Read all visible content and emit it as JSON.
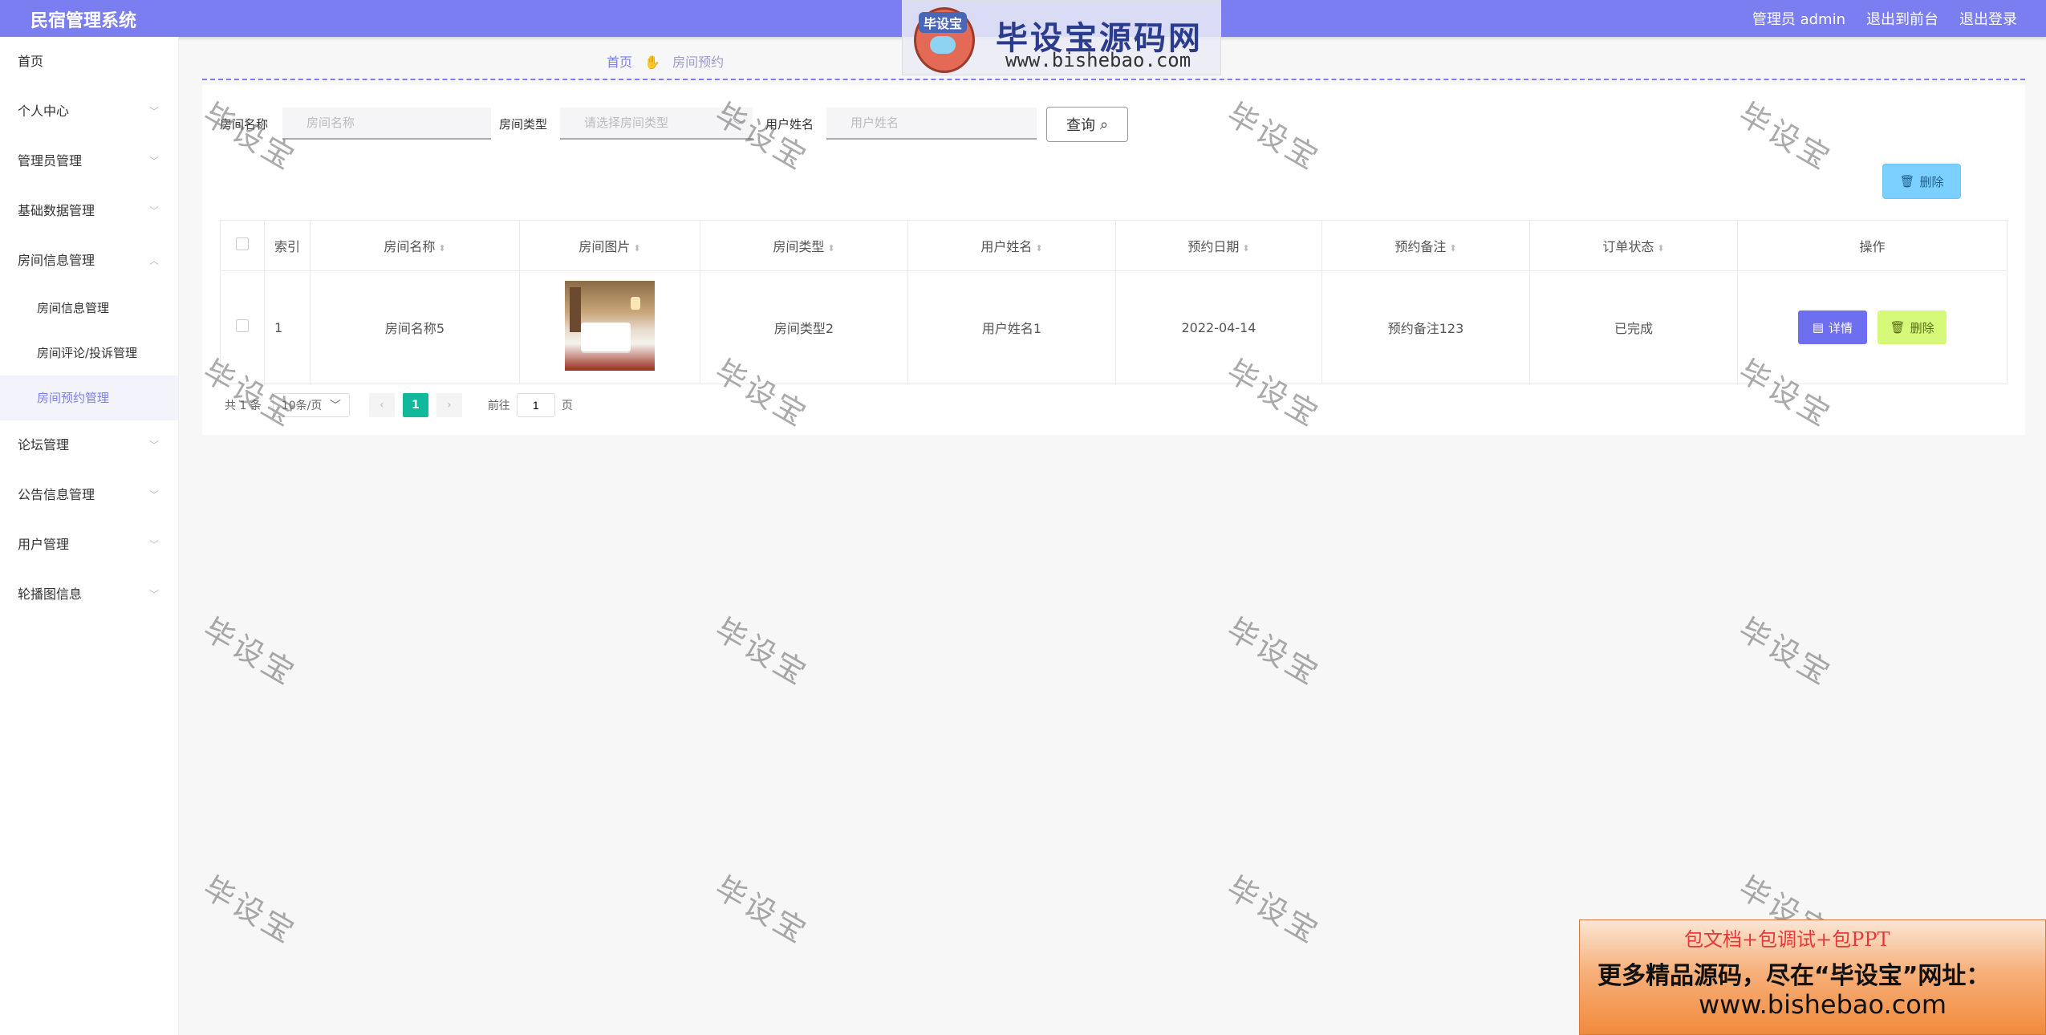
{
  "header": {
    "title": "民宿管理系统",
    "admin_label": "管理员 admin",
    "exit_front": "退出到前台",
    "logout": "退出登录",
    "brand_color": "#7b7ef0"
  },
  "watermark_logo": {
    "tag": "毕设宝",
    "title": "毕设宝源码网",
    "url": "www.bishebao.com"
  },
  "sidebar": {
    "items": [
      {
        "label": "首页"
      },
      {
        "label": "个人中心"
      },
      {
        "label": "管理员管理"
      },
      {
        "label": "基础数据管理"
      },
      {
        "label": "房间信息管理"
      },
      {
        "label": "论坛管理"
      },
      {
        "label": "公告信息管理"
      },
      {
        "label": "用户管理"
      },
      {
        "label": "轮播图信息"
      }
    ],
    "subitems": [
      {
        "label": "房间信息管理"
      },
      {
        "label": "房间评论/投诉管理"
      },
      {
        "label": "房间预约管理"
      }
    ]
  },
  "breadcrumb": {
    "home": "首页",
    "current": "房间预约"
  },
  "search": {
    "room_name_label": "房间名称",
    "room_name_placeholder": "房间名称",
    "room_type_label": "房间类型",
    "room_type_placeholder": "请选择房间类型",
    "user_name_label": "用户姓名",
    "user_name_placeholder": "用户姓名",
    "query_label": "查询"
  },
  "toolbar": {
    "delete_label": "删除"
  },
  "table": {
    "headers": [
      "索引",
      "房间名称",
      "房间图片",
      "房间类型",
      "用户姓名",
      "预约日期",
      "预约备注",
      "订单状态",
      "操作"
    ],
    "rows": [
      {
        "index": "1",
        "room_name": "房间名称5",
        "room_type": "房间类型2",
        "user_name": "用户姓名1",
        "date": "2022-04-14",
        "note": "预约备注123",
        "status": "已完成",
        "detail_label": "详情",
        "delete_label": "删除"
      }
    ]
  },
  "pagination": {
    "total": "共 1 条",
    "page_size": "10条/页",
    "current_page": "1",
    "goto_prefix": "前往",
    "goto_value": "1",
    "goto_suffix": "页"
  },
  "watermark_text": "毕设宝",
  "promo": {
    "line1": "包文档+包调试+包PPT",
    "line2": "更多精品源码，尽在“毕设宝”网址：",
    "line3": "www.bishebao.com"
  }
}
